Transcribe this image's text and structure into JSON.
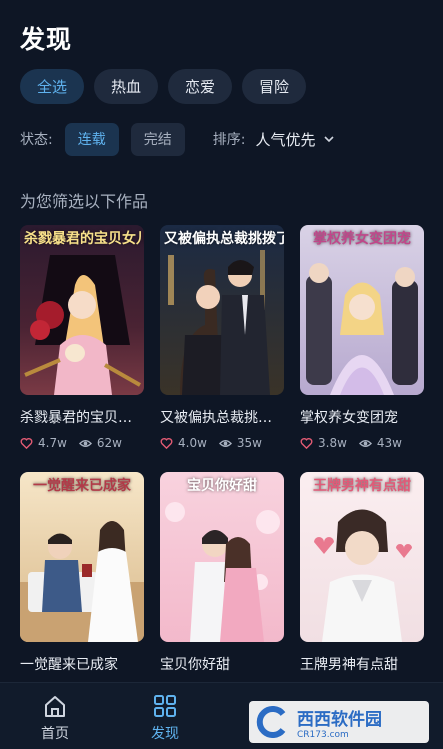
{
  "page": {
    "title": "发现"
  },
  "tabs": [
    {
      "label": "全选",
      "active": true
    },
    {
      "label": "热血",
      "active": false
    },
    {
      "label": "恋爱",
      "active": false
    },
    {
      "label": "冒险",
      "active": false
    }
  ],
  "filters": {
    "status_label": "状态:",
    "status_options": [
      {
        "label": "连载",
        "active": true
      },
      {
        "label": "完结",
        "active": false
      }
    ],
    "sort_label": "排序:",
    "sort_value": "人气优先"
  },
  "section": {
    "title": "为您筛选以下作品"
  },
  "works": [
    {
      "name": "杀戮暴君的宝贝女儿",
      "cover_title": "杀戮暴君的宝贝女儿",
      "likes": "4.7w",
      "views": "62w"
    },
    {
      "name": "又被偏执总裁挑拨了",
      "cover_title": "又被偏执总裁挑拨了",
      "likes": "4.0w",
      "views": "35w"
    },
    {
      "name": "掌权养女变团宠",
      "cover_title": "掌权养女变团宠",
      "likes": "3.8w",
      "views": "43w"
    },
    {
      "name": "一觉醒来已成家",
      "cover_title": "一觉醒来已成家"
    },
    {
      "name": "宝贝你好甜",
      "cover_title": "宝贝你好甜"
    },
    {
      "name": "王牌男神有点甜",
      "cover_title": "王牌男神有点甜"
    }
  ],
  "nav": [
    {
      "label": "首页",
      "icon": "home-icon",
      "active": false
    },
    {
      "label": "发现",
      "icon": "grid-icon",
      "active": true
    }
  ],
  "watermark": {
    "brand": "西西软件园",
    "site": "CR173.com"
  },
  "colors": {
    "accent": "#5fb2ee",
    "background": "#0e1625",
    "like": "#e25b74"
  }
}
